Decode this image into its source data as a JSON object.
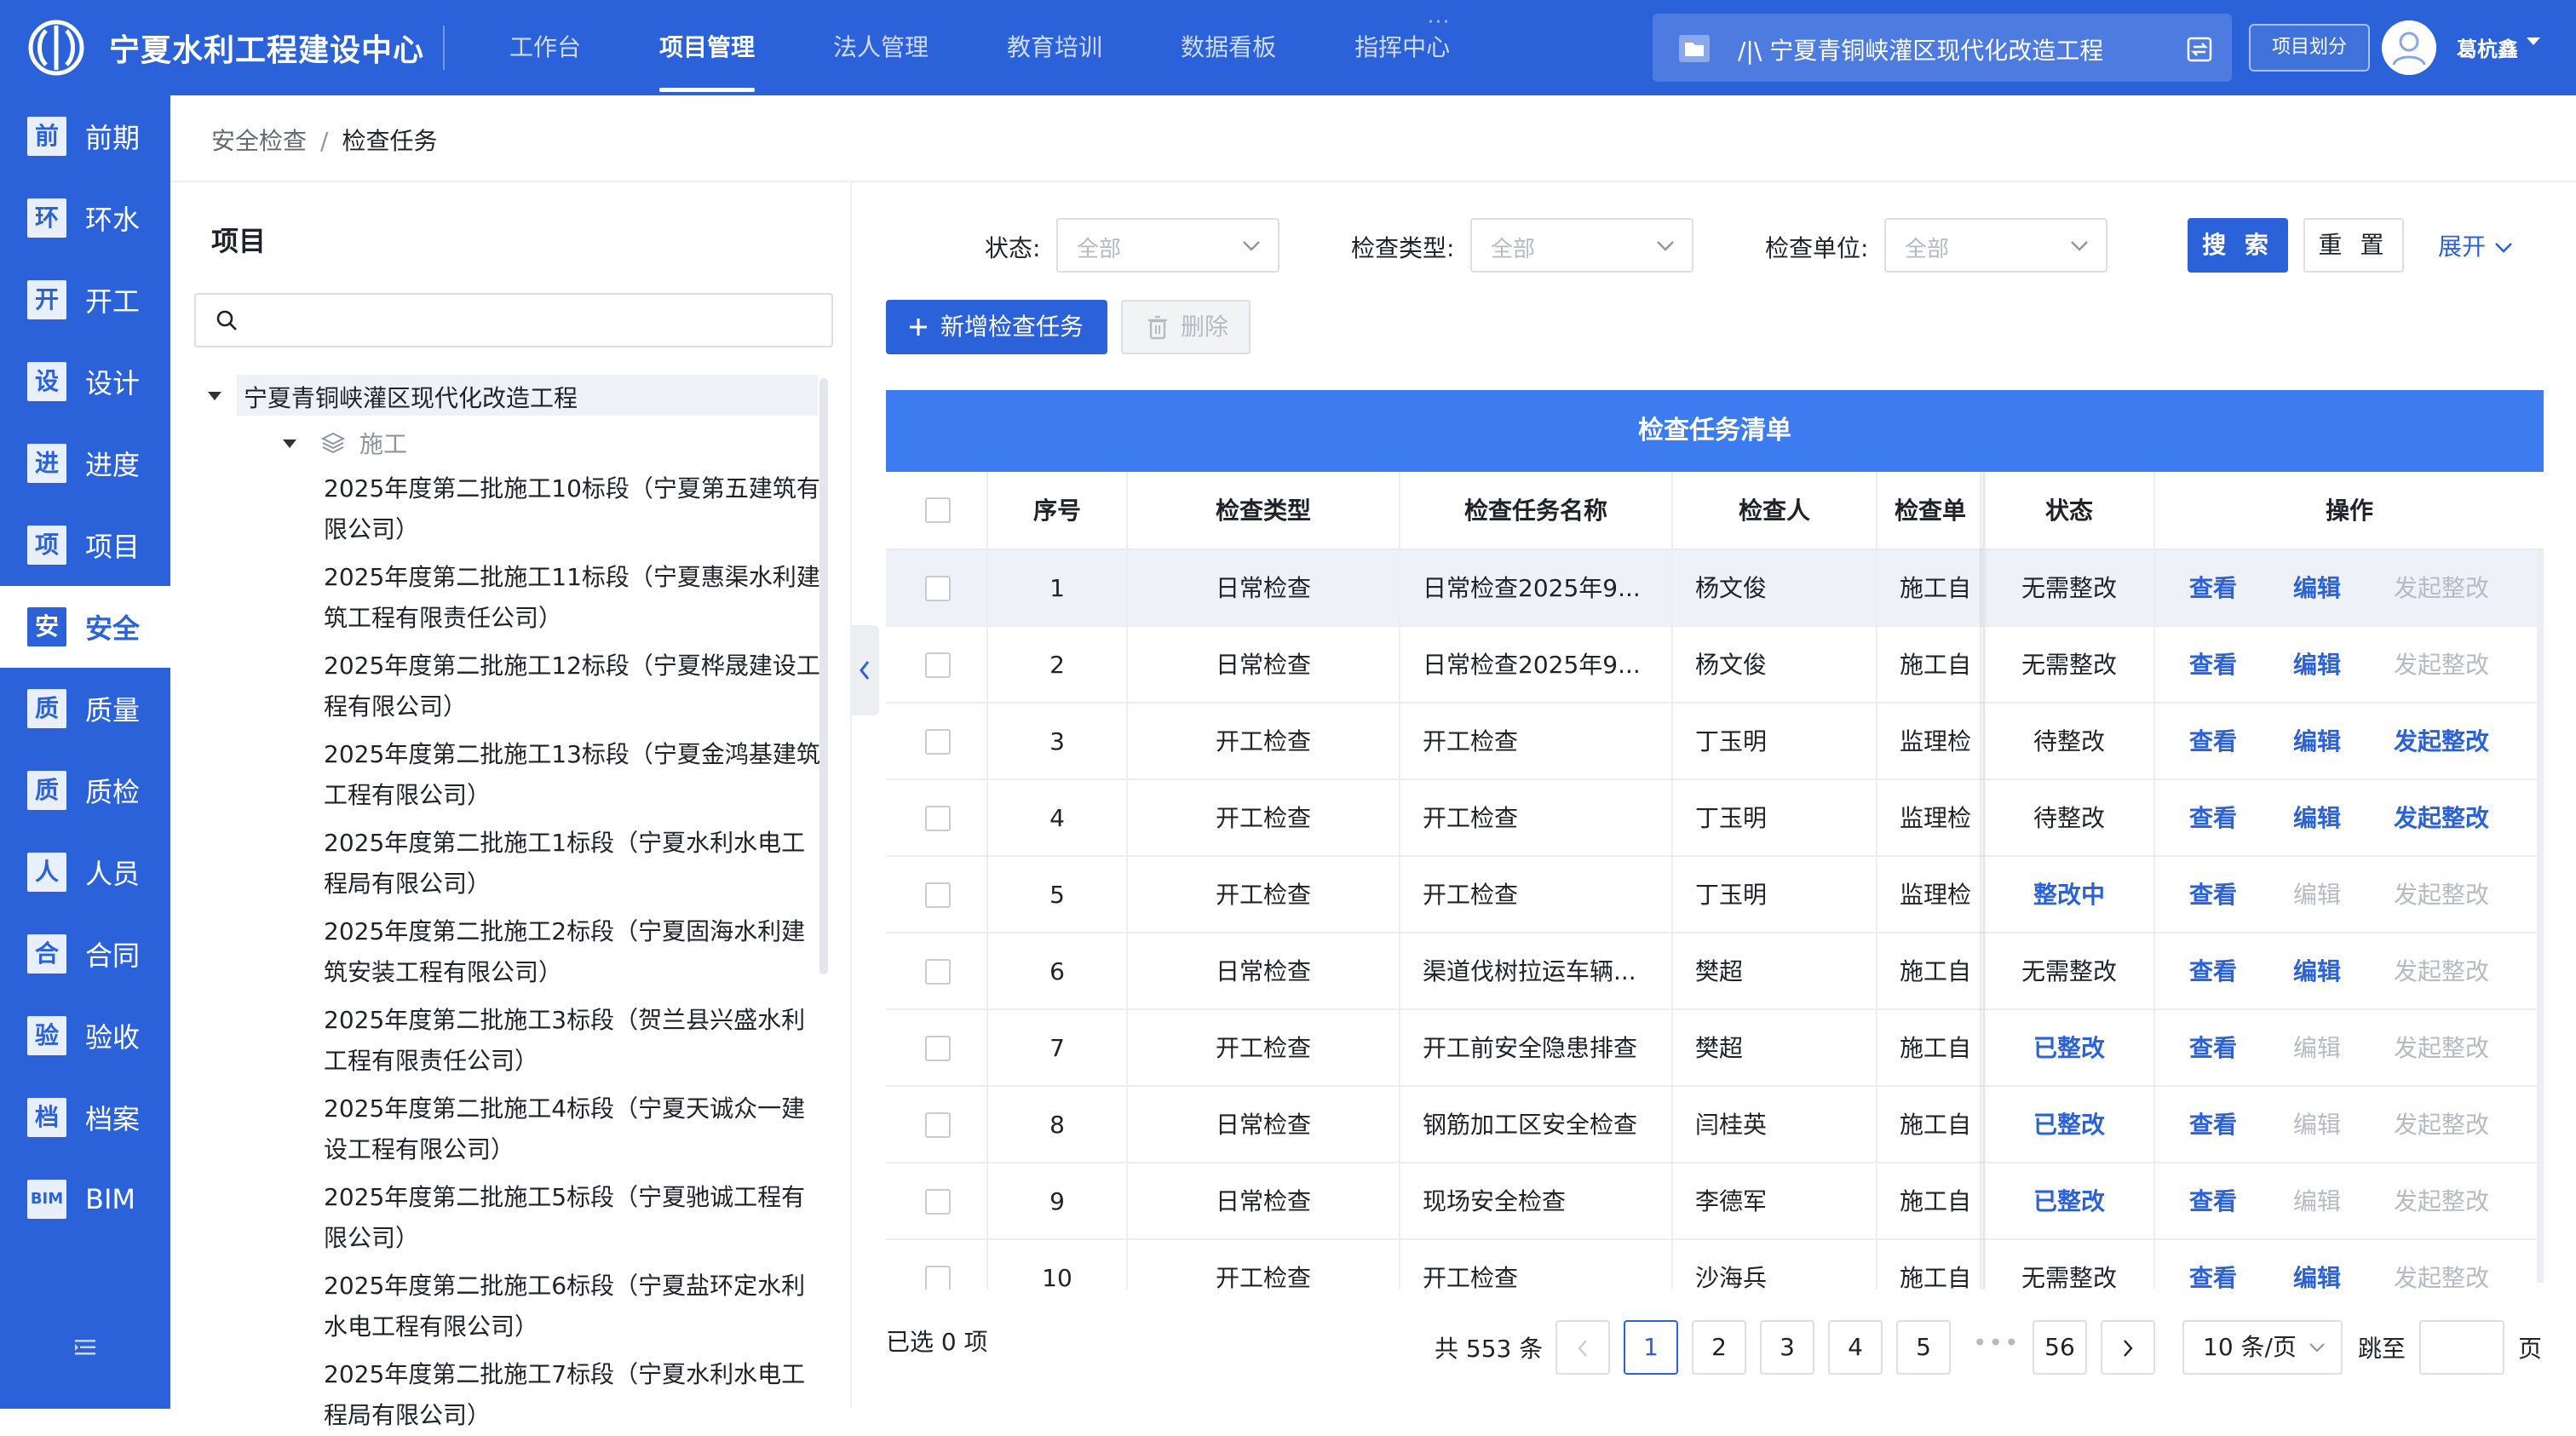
{
  "header": {
    "brand": "宁夏水利工程建设中心",
    "nav": [
      "工作台",
      "项目管理",
      "法人管理",
      "教育培训",
      "数据看板",
      "指挥中心"
    ],
    "active_nav": "项目管理",
    "project_path": "/|\\ 宁夏青铜峡灌区现代化改造工程",
    "project_divide_button": "项目划分",
    "username": "葛杭鑫",
    "brand_color": "#2b62d9"
  },
  "sidebar": {
    "items": [
      {
        "icon": "前",
        "label": "前期"
      },
      {
        "icon": "环",
        "label": "环水"
      },
      {
        "icon": "开",
        "label": "开工"
      },
      {
        "icon": "设",
        "label": "设计"
      },
      {
        "icon": "进",
        "label": "进度"
      },
      {
        "icon": "项",
        "label": "项目"
      },
      {
        "icon": "安",
        "label": "安全"
      },
      {
        "icon": "质",
        "label": "质量"
      },
      {
        "icon": "质",
        "label": "质检"
      },
      {
        "icon": "人",
        "label": "人员"
      },
      {
        "icon": "合",
        "label": "合同"
      },
      {
        "icon": "验",
        "label": "验收"
      },
      {
        "icon": "档",
        "label": "档案"
      },
      {
        "icon": "BIM",
        "label": "BIM"
      }
    ],
    "active": "安全"
  },
  "breadcrumb": {
    "parent": "安全检查",
    "separator": "/",
    "current": "检查任务"
  },
  "tree": {
    "title": "项目",
    "search_placeholder": "",
    "root": "宁夏青铜峡灌区现代化改造工程",
    "group": "施工",
    "leaves": [
      "2025年度第二批施工10标段（宁夏第五建筑有限公司）",
      "2025年度第二批施工11标段（宁夏惠渠水利建筑工程有限责任公司）",
      "2025年度第二批施工12标段（宁夏桦晟建设工程有限公司）",
      "2025年度第二批施工13标段（宁夏金鸿基建筑工程有限公司）",
      "2025年度第二批施工1标段（宁夏水利水电工程局有限公司）",
      "2025年度第二批施工2标段（宁夏固海水利建筑安装工程有限公司）",
      "2025年度第二批施工3标段（贺兰县兴盛水利工程有限责任公司）",
      "2025年度第二批施工4标段（宁夏天诚众一建设工程有限公司）",
      "2025年度第二批施工5标段（宁夏驰诚工程有限公司）",
      "2025年度第二批施工6标段（宁夏盐环定水利水电工程有限公司）",
      "2025年度第二批施工7标段（宁夏水利水电工程局有限公司）"
    ]
  },
  "filters": {
    "status_label": "状态:",
    "status_value": "全部",
    "type_label": "检查类型:",
    "type_value": "全部",
    "unit_label": "检查单位:",
    "unit_value": "全部",
    "search_button": "搜 索",
    "reset_button": "重 置",
    "expand_button": "展开"
  },
  "actions": {
    "add_button": "新增检查任务",
    "delete_button": "删除"
  },
  "table": {
    "title": "检查任务清单",
    "columns": [
      "序号",
      "检查类型",
      "检查任务名称",
      "检查人",
      "检查单",
      "状态",
      "操作"
    ],
    "rows": [
      {
        "no": "1",
        "type": "日常检查",
        "name": "日常检查2025年9...",
        "inspector": "杨文俊",
        "unit": "施工自",
        "status": "无需整改",
        "status_blue": false,
        "view": "查看",
        "edit": "编辑",
        "edit_on": true,
        "rect": "发起整改",
        "rect_on": false
      },
      {
        "no": "2",
        "type": "日常检查",
        "name": "日常检查2025年9...",
        "inspector": "杨文俊",
        "unit": "施工自",
        "status": "无需整改",
        "status_blue": false,
        "view": "查看",
        "edit": "编辑",
        "edit_on": true,
        "rect": "发起整改",
        "rect_on": false
      },
      {
        "no": "3",
        "type": "开工检查",
        "name": "开工检查",
        "inspector": "丁玉明",
        "unit": "监理检",
        "status": "待整改",
        "status_blue": false,
        "view": "查看",
        "edit": "编辑",
        "edit_on": true,
        "rect": "发起整改",
        "rect_on": true
      },
      {
        "no": "4",
        "type": "开工检查",
        "name": "开工检查",
        "inspector": "丁玉明",
        "unit": "监理检",
        "status": "待整改",
        "status_blue": false,
        "view": "查看",
        "edit": "编辑",
        "edit_on": true,
        "rect": "发起整改",
        "rect_on": true
      },
      {
        "no": "5",
        "type": "开工检查",
        "name": "开工检查",
        "inspector": "丁玉明",
        "unit": "监理检",
        "status": "整改中",
        "status_blue": true,
        "view": "查看",
        "edit": "编辑",
        "edit_on": false,
        "rect": "发起整改",
        "rect_on": false
      },
      {
        "no": "6",
        "type": "日常检查",
        "name": "渠道伐树拉运车辆...",
        "inspector": "樊超",
        "unit": "施工自",
        "status": "无需整改",
        "status_blue": false,
        "view": "查看",
        "edit": "编辑",
        "edit_on": true,
        "rect": "发起整改",
        "rect_on": false
      },
      {
        "no": "7",
        "type": "开工检查",
        "name": "开工前安全隐患排查",
        "inspector": "樊超",
        "unit": "施工自",
        "status": "已整改",
        "status_blue": true,
        "view": "查看",
        "edit": "编辑",
        "edit_on": false,
        "rect": "发起整改",
        "rect_on": false
      },
      {
        "no": "8",
        "type": "日常检查",
        "name": "钢筋加工区安全检查",
        "inspector": "闫桂英",
        "unit": "施工自",
        "status": "已整改",
        "status_blue": true,
        "view": "查看",
        "edit": "编辑",
        "edit_on": false,
        "rect": "发起整改",
        "rect_on": false
      },
      {
        "no": "9",
        "type": "日常检查",
        "name": "现场安全检查",
        "inspector": "李德军",
        "unit": "施工自",
        "status": "已整改",
        "status_blue": true,
        "view": "查看",
        "edit": "编辑",
        "edit_on": false,
        "rect": "发起整改",
        "rect_on": false
      },
      {
        "no": "10",
        "type": "开工检查",
        "name": "开工检查",
        "inspector": "沙海兵",
        "unit": "施工自",
        "status": "无需整改",
        "status_blue": false,
        "view": "查看",
        "edit": "编辑",
        "edit_on": true,
        "rect": "发起整改",
        "rect_on": false
      }
    ]
  },
  "footer": {
    "selected": "已选 0 项",
    "total": "共 553 条",
    "pages": [
      "1",
      "2",
      "3",
      "4",
      "5",
      "56"
    ],
    "current_page": "1",
    "ellipsis": "•••",
    "page_size": "10 条/页",
    "jump_label": "跳至",
    "page_unit": "页"
  }
}
